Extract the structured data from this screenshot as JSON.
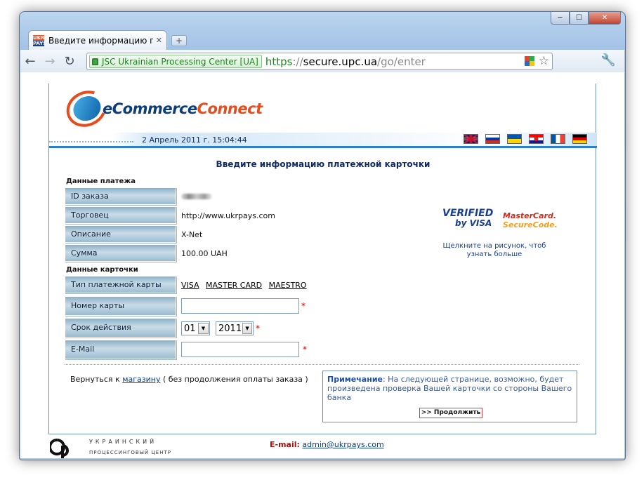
{
  "browser": {
    "tab_title": "Введите информацию п...",
    "tab_close": "✕",
    "new_tab": "+",
    "favicon_top": "UKR",
    "favicon_bottom": "PAYS",
    "ev_label": "JSC Ukrainian Processing Center [UA]",
    "url_scheme": "https",
    "url_sep": "://",
    "url_host": "secure.upc.ua",
    "url_path": "/go/enter",
    "win_min": "─",
    "win_max": "☐",
    "win_close": "✕"
  },
  "header": {
    "logo_part1": "eCommerce",
    "logo_part2": "Connect",
    "datetime": "2 Апрель 2011 г. 15:04:44",
    "flags": [
      {
        "name": "UK",
        "colors": [
          "#012169",
          "#ffffff",
          "#c8102e"
        ]
      },
      {
        "name": "RU",
        "colors": [
          "#ffffff",
          "#0039a6",
          "#d52b1e"
        ]
      },
      {
        "name": "UA",
        "colors": [
          "#0057b7",
          "#ffd700"
        ]
      },
      {
        "name": "HR",
        "colors": [
          "#ff0000",
          "#ffffff",
          "#171796"
        ]
      },
      {
        "name": "FR",
        "colors": [
          "#0055a4",
          "#ffffff",
          "#ef4135"
        ]
      },
      {
        "name": "DE",
        "colors": [
          "#000000",
          "#dd0000",
          "#ffce00"
        ]
      }
    ]
  },
  "form": {
    "title": "Введите информацию платежной карточки",
    "payment_section": "Данные платежа",
    "order_id_label": "ID заказа",
    "merchant_label": "Торговец",
    "merchant_value": "http://www.ukrpays.com",
    "description_label": "Описание",
    "description_value": "X-Net",
    "amount_label": "Сумма",
    "amount_value": "100.00 UAH",
    "card_section": "Данные карточки",
    "card_type_label": "Тип платежной карты",
    "card_types": [
      "VISA",
      "MASTER CARD",
      "MAESTRO"
    ],
    "card_number_label": "Номер карты",
    "card_number_value": "",
    "expiry_label": "Срок действия",
    "expiry_month": "01",
    "expiry_year": "2011",
    "email_label": "E-Mail",
    "email_value": "",
    "required_mark": "*",
    "select_arrow": "▼"
  },
  "badges": {
    "verified_line1": "VERIFIED",
    "verified_line2": "by VISA",
    "mc_line1": "MasterCard.",
    "mc_line2": "SecureCode.",
    "caption_line1": "Щелкните на рисунок, чтоб",
    "caption_line2": "узнать больше"
  },
  "back": {
    "prefix": "Вернуться к",
    "link": "магазину",
    "suffix": "( без продолжения оплаты заказа )"
  },
  "note": {
    "heading": "Примечание",
    "text": ": На следующей странице, возможно, будет произведена проверка Вашей карточки со стороны Вашего банка",
    "continue_button": ">> Продолжить"
  },
  "footer": {
    "company_line1": "УКРАИНСКИЙ",
    "company_line2": "ПРОЦЕССИНГОВЫЙ ЦЕНТР",
    "email_label": "E-mail:",
    "email_value": "admin@ukrpays.com"
  },
  "colors": {
    "accent_blue": "#2b7fcb",
    "brand_orange": "#e84b1c",
    "required_red": "#cc0000",
    "ev_green": "#178a17"
  }
}
